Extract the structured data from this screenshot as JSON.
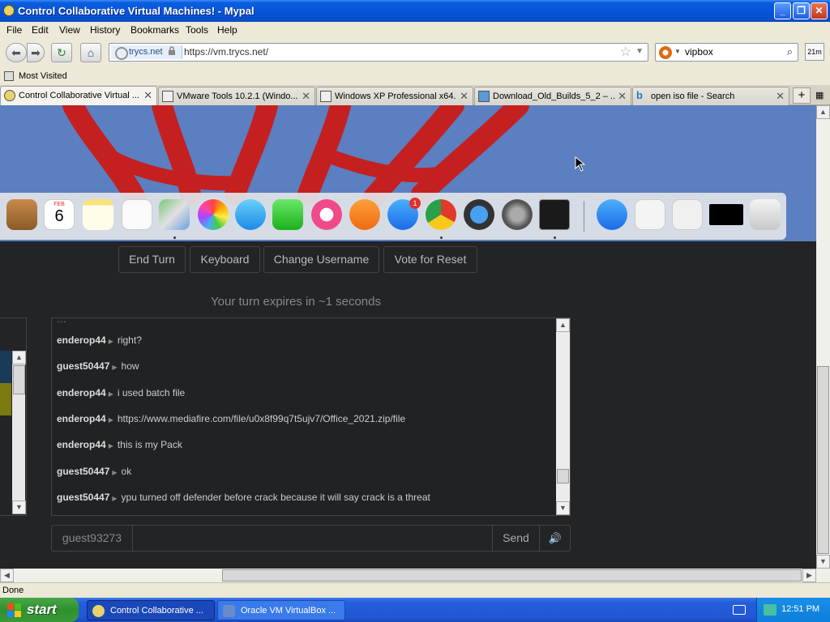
{
  "window": {
    "title": "Control Collaborative Virtual Machines! - Mypal",
    "minimize": "_",
    "maximize": "❐",
    "close": "✕"
  },
  "menu": [
    "File",
    "Edit",
    "View",
    "History",
    "Bookmarks",
    "Tools",
    "Help"
  ],
  "nav": {
    "site_identity": "trycs.net",
    "url": "https://vm.trycs.net/",
    "search_value": "vipbox",
    "zoom": "21m"
  },
  "bookmarks": {
    "most_visited": "Most Visited"
  },
  "tabs": [
    {
      "label": "Control Collaborative Virtual ...",
      "active": true
    },
    {
      "label": "VMware Tools 10.2.1 (Windo...",
      "active": false
    },
    {
      "label": "Windows XP Professional x64...",
      "active": false
    },
    {
      "label": "Download_Old_Builds_5_2 – ...",
      "active": false
    },
    {
      "label": "open iso file - Search",
      "active": false
    }
  ],
  "dock": {
    "calendar_month": "FEB",
    "calendar_day": "6",
    "appstore_badge": "1"
  },
  "controls": {
    "end_turn": "End Turn",
    "keyboard": "Keyboard",
    "change_username": "Change Username",
    "vote_reset": "Vote for Reset"
  },
  "turn_message": "Your turn expires in ~1 seconds",
  "chat": [
    {
      "user": "enderop44",
      "text": "right?"
    },
    {
      "user": "guest50447",
      "text": "how"
    },
    {
      "user": "enderop44",
      "text": "i used batch file"
    },
    {
      "user": "enderop44",
      "text": "https://www.mediafire.com/file/u0x8f99q7t5ujv7/Office_2021.zip/file"
    },
    {
      "user": "enderop44",
      "text": "this is my Pack"
    },
    {
      "user": "guest50447",
      "text": "ok"
    },
    {
      "user": "guest50447",
      "text": "ypu turned off defender before crack because it will say crack is a threat"
    }
  ],
  "chat_input": {
    "username": "guest93273",
    "send": "Send",
    "volume": "🔊"
  },
  "status": "Done",
  "taskbar": {
    "start": "start",
    "items": [
      {
        "label": "Control Collaborative ..."
      },
      {
        "label": "Oracle VM VirtualBox ..."
      }
    ],
    "clock": "12:51 PM"
  },
  "colors": {
    "xp_blue": "#0a5ee0",
    "page_bg": "#222426",
    "start_green": "#2f8f2f"
  }
}
